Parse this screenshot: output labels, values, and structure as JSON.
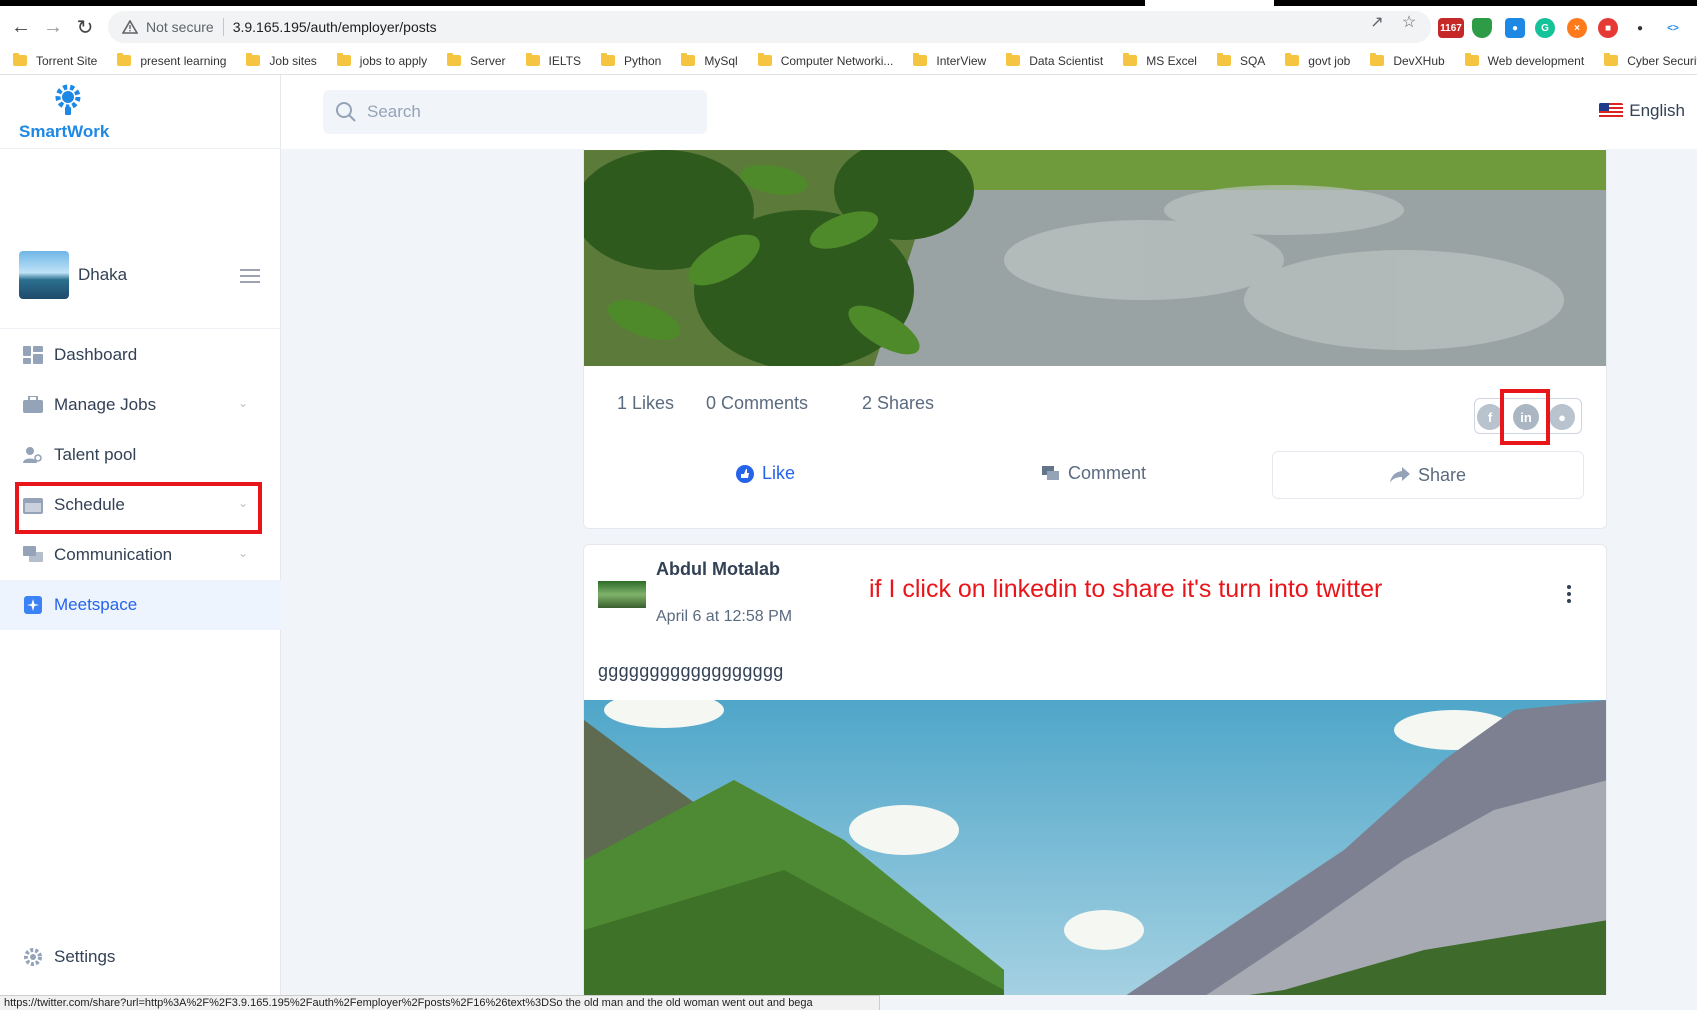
{
  "browser": {
    "security_label": "Not secure",
    "url": "3.9.165.195/auth/employer/posts",
    "gmail_badge": "1167",
    "bookmarks": [
      "Torrent Site",
      "present learning",
      "Job sites",
      "jobs to apply",
      "Server",
      "IELTS",
      "Python",
      "MySql",
      "Computer Networki...",
      "InterView",
      "Data Scientist",
      "MS Excel",
      "SQA",
      "govt job",
      "DevXHub",
      "Web development",
      "Cyber Security"
    ],
    "status_url": "https://twitter.com/share?url=http%3A%2F%2F3.9.165.195%2Fauth%2Femployer%2Fposts%2F16%26text%3DSo the old man and the old woman went out and bega"
  },
  "app": {
    "brand": "SmartWork",
    "brand_color": "#1e88e5",
    "user_name": "Dhaka",
    "search_placeholder": "Search",
    "language": "English",
    "nav": [
      {
        "label": "Dashboard",
        "icon": "dashboard-icon"
      },
      {
        "label": "Manage Jobs",
        "icon": "briefcase-icon"
      },
      {
        "label": "Talent pool",
        "icon": "user-search-icon"
      },
      {
        "label": "Schedule",
        "icon": "calendar-icon"
      },
      {
        "label": "Communication",
        "icon": "chat-icon"
      },
      {
        "label": "Meetspace",
        "icon": "meetspace-icon"
      }
    ],
    "active_nav": "Meetspace",
    "settings_label": "Settings"
  },
  "post1": {
    "likes": "1 Likes",
    "comments": "0 Comments",
    "shares": "2 Shares",
    "like_label": "Like",
    "comment_label": "Comment",
    "share_label": "Share",
    "share_targets": [
      "facebook-icon",
      "linkedin-icon",
      "twitter-icon"
    ]
  },
  "post2": {
    "author": "Abdul Motalab",
    "time": "April 6 at 12:58 PM",
    "text": "gggggggggggggggggg"
  },
  "annotation": {
    "text": "if I click on linkedin to share it's turn into twitter",
    "color": "#e8161b"
  }
}
